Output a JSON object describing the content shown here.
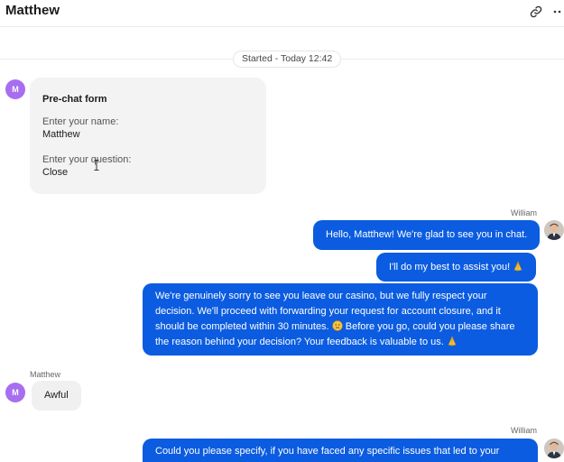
{
  "header": {
    "title": "Matthew",
    "link_icon": "link-icon",
    "more_icon": "more-dots-icon"
  },
  "timeline": {
    "started_label": "Started - Today 12:42"
  },
  "prechat": {
    "avatar_initial": "M",
    "title": "Pre-chat form",
    "fields": [
      {
        "label": "Enter your name:",
        "value": "Matthew"
      },
      {
        "label": "Enter your question:",
        "value": "Close"
      }
    ]
  },
  "messages": [
    {
      "sender": "William",
      "direction": "outgoing",
      "text": "Hello, Matthew! We're glad to see you in chat."
    },
    {
      "sender": "William",
      "direction": "outgoing",
      "text": "I'll do my best to assist you!",
      "emoji": "folded-hands-icon"
    },
    {
      "sender": "William",
      "direction": "outgoing",
      "lines": [
        "We're genuinely sorry to see you leave our casino, but we fully respect your",
        "decision. We'll proceed with forwarding your request for account closure, and it",
        "should be completed within 30 minutes.",
        "Before you go, could you please share",
        "the reason behind your decision? Your feedback is valuable to us."
      ],
      "emojis": [
        "sad-face-icon",
        "folded-hands-icon"
      ]
    },
    {
      "sender": "Matthew",
      "direction": "incoming",
      "avatar_initial": "M",
      "text": "Awful"
    },
    {
      "sender": "William",
      "direction": "outgoing",
      "text": "Could you please specify, if you have faced any specific issues that led to your"
    }
  ],
  "colors": {
    "outgoing_bubble": "#0b5ce0",
    "incoming_bubble": "#f0f0f0",
    "customer_avatar": "#a86ef0",
    "form_card": "#f3f3f3"
  }
}
